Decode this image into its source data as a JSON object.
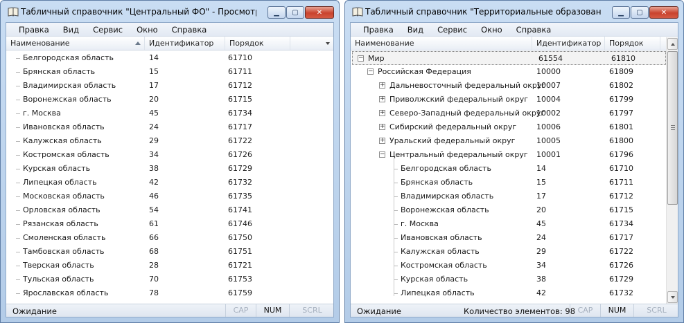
{
  "menu": [
    "Правка",
    "Вид",
    "Сервис",
    "Окно",
    "Справка"
  ],
  "colors": {
    "accent": "#c9432e",
    "frame": "#b3cce8"
  },
  "win1": {
    "title": "Табличный справочник \"Центральный ФО\" - Просмотр",
    "columns": [
      "Наименование",
      "Идентификатор",
      "Порядок"
    ],
    "rows": [
      [
        "Белгородская область",
        "14",
        "61710"
      ],
      [
        "Брянская область",
        "15",
        "61711"
      ],
      [
        "Владимирская область",
        "17",
        "61712"
      ],
      [
        "Воронежская область",
        "20",
        "61715"
      ],
      [
        "г. Москва",
        "45",
        "61734"
      ],
      [
        "Ивановская область",
        "24",
        "61717"
      ],
      [
        "Калужская область",
        "29",
        "61722"
      ],
      [
        "Костромская область",
        "34",
        "61726"
      ],
      [
        "Курская область",
        "38",
        "61729"
      ],
      [
        "Липецкая область",
        "42",
        "61732"
      ],
      [
        "Московская область",
        "46",
        "61735"
      ],
      [
        "Орловская область",
        "54",
        "61741"
      ],
      [
        "Рязанская область",
        "61",
        "61746"
      ],
      [
        "Смоленская область",
        "66",
        "61750"
      ],
      [
        "Тамбовская область",
        "68",
        "61751"
      ],
      [
        "Тверская область",
        "28",
        "61721"
      ],
      [
        "Тульская область",
        "70",
        "61753"
      ],
      [
        "Ярославская область",
        "78",
        "61759"
      ]
    ],
    "status": "Ожидание",
    "indicators": [
      {
        "label": "CAP",
        "on": false
      },
      {
        "label": "NUM",
        "on": true
      },
      {
        "label": "SCRL",
        "on": false
      }
    ]
  },
  "win2": {
    "title": "Табличный справочник \"Территориальные образования\" - ...",
    "columns": [
      "Наименование",
      "Идентификатор",
      "Порядок"
    ],
    "rows": [
      {
        "name": "Мир",
        "id": "61554",
        "order": "61810",
        "level": 0,
        "state": "expanded",
        "selected": true
      },
      {
        "name": "Российская Федерация",
        "id": "10000",
        "order": "61809",
        "level": 1,
        "state": "expanded"
      },
      {
        "name": "Дальневосточный федеральный округ",
        "id": "10007",
        "order": "61802",
        "level": 2,
        "state": "collapsed"
      },
      {
        "name": "Приволжский федеральный округ",
        "id": "10004",
        "order": "61799",
        "level": 2,
        "state": "collapsed"
      },
      {
        "name": "Северо-Западный федеральный округ",
        "id": "10002",
        "order": "61797",
        "level": 2,
        "state": "collapsed"
      },
      {
        "name": "Сибирский федеральный округ",
        "id": "10006",
        "order": "61801",
        "level": 2,
        "state": "collapsed"
      },
      {
        "name": "Уральский федеральный округ",
        "id": "10005",
        "order": "61800",
        "level": 2,
        "state": "collapsed"
      },
      {
        "name": "Центральный федеральный округ",
        "id": "10001",
        "order": "61796",
        "level": 2,
        "state": "expanded"
      },
      {
        "name": "Белгородская область",
        "id": "14",
        "order": "61710",
        "level": 3,
        "state": "leaf"
      },
      {
        "name": "Брянская область",
        "id": "15",
        "order": "61711",
        "level": 3,
        "state": "leaf"
      },
      {
        "name": "Владимирская область",
        "id": "17",
        "order": "61712",
        "level": 3,
        "state": "leaf"
      },
      {
        "name": "Воронежская область",
        "id": "20",
        "order": "61715",
        "level": 3,
        "state": "leaf"
      },
      {
        "name": "г. Москва",
        "id": "45",
        "order": "61734",
        "level": 3,
        "state": "leaf"
      },
      {
        "name": "Ивановская область",
        "id": "24",
        "order": "61717",
        "level": 3,
        "state": "leaf"
      },
      {
        "name": "Калужская область",
        "id": "29",
        "order": "61722",
        "level": 3,
        "state": "leaf"
      },
      {
        "name": "Костромская область",
        "id": "34",
        "order": "61726",
        "level": 3,
        "state": "leaf"
      },
      {
        "name": "Курская область",
        "id": "38",
        "order": "61729",
        "level": 3,
        "state": "leaf"
      },
      {
        "name": "Липецкая область",
        "id": "42",
        "order": "61732",
        "level": 3,
        "state": "leaf"
      }
    ],
    "status": "Ожидание",
    "count_text": "Количество элементов: 98",
    "indicators": [
      {
        "label": "CAP",
        "on": false
      },
      {
        "label": "NUM",
        "on": true
      },
      {
        "label": "SCRL",
        "on": false
      }
    ]
  }
}
